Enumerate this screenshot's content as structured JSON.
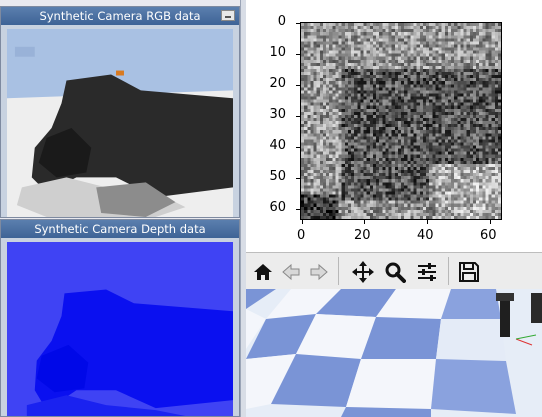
{
  "rgb_window": {
    "title": "Synthetic Camera RGB data"
  },
  "depth_window": {
    "title": "Synthetic Camera Depth data"
  },
  "plot": {
    "yticks": [
      "0",
      "10",
      "20",
      "30",
      "40",
      "50",
      "60"
    ],
    "xticks": [
      "0",
      "20",
      "40",
      "60"
    ]
  },
  "toolbar": {
    "items": [
      "home-icon",
      "back-arrow-icon",
      "forward-arrow-icon",
      "pan-move-icon",
      "zoom-magnifier-icon",
      "subplots-configure-icon",
      "save-floppy-icon"
    ]
  },
  "colors": {
    "title_bar": "#4a6ea0",
    "depth_background": "#3f43f4",
    "depth_object": "#0a10f0",
    "sky": "#a9c1e3"
  }
}
